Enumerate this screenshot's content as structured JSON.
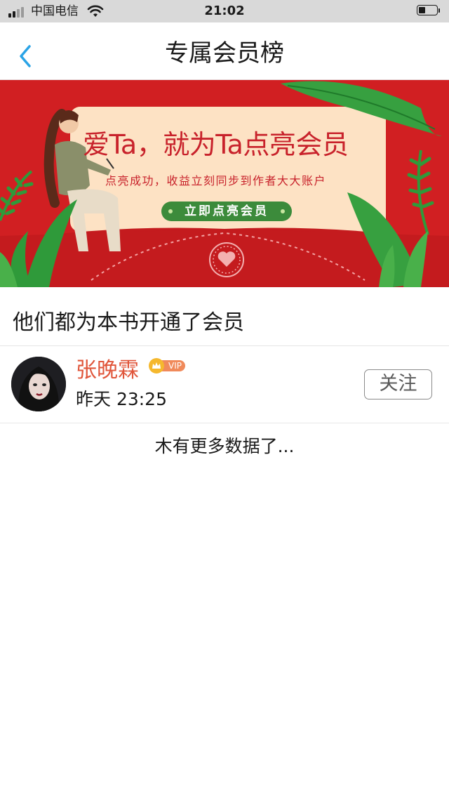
{
  "status_bar": {
    "carrier": "中国电信",
    "time": "21:02"
  },
  "nav": {
    "title": "专属会员榜",
    "back_icon": "chevron-left-icon"
  },
  "banner": {
    "headline": "爱Ta，就为Ta点亮会员",
    "subtitle": "点亮成功，收益立刻同步到作者大大账户",
    "button_label": "立即点亮会员",
    "colors": {
      "red": "#d11f22",
      "paper": "#fde2c4",
      "green": "#3c8b3b",
      "leaf": "#2f9a3a"
    }
  },
  "section": {
    "title": "他们都为本书开通了会员"
  },
  "members": [
    {
      "name": "张晚霖",
      "badge": "VIP",
      "time": "昨天 23:25",
      "follow_label": "关注"
    }
  ],
  "footer": {
    "no_more_text": "木有更多数据了..."
  }
}
